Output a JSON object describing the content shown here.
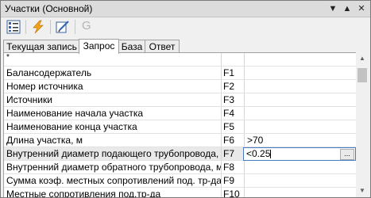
{
  "window": {
    "title": "Участки (Основной)",
    "controls": {
      "dropdown": "▼",
      "collapse": "▲",
      "close": "✕"
    }
  },
  "toolbar": {
    "buttons": [
      {
        "name": "list-view-icon",
        "enabled": true
      },
      {
        "name": "lightning-icon",
        "enabled": true
      },
      {
        "name": "edit-icon",
        "enabled": true
      },
      {
        "name": "g-icon",
        "label": "G",
        "enabled": false
      }
    ]
  },
  "tabs": [
    {
      "label": "Текущая запись",
      "active": false
    },
    {
      "label": "Запрос",
      "active": true
    },
    {
      "label": "База",
      "active": false
    },
    {
      "label": "Ответ",
      "active": false
    }
  ],
  "grid": {
    "header_marker": "*",
    "rows": [
      {
        "name": "Балансодержатель",
        "field": "F1",
        "value": ""
      },
      {
        "name": "Номер источника",
        "field": "F2",
        "value": ""
      },
      {
        "name": "Источники",
        "field": "F3",
        "value": ""
      },
      {
        "name": "Наименование начала участка",
        "field": "F4",
        "value": ""
      },
      {
        "name": "Наименование конца участка",
        "field": "F5",
        "value": ""
      },
      {
        "name": "Длина участка, м",
        "field": "F6",
        "value": ">70"
      },
      {
        "name": "Внутренний диаметр подающего трубопровода, м",
        "field": "F7",
        "value": "<0.25",
        "editing": true
      },
      {
        "name": "Внутренний диаметр обратного трубопровода, м",
        "field": "F8",
        "value": ""
      },
      {
        "name": "Сумма коэф. местных сопротивлений под. тр-да",
        "field": "F9",
        "value": ""
      },
      {
        "name": "Местные сопротивления под.тр-да",
        "field": "F10",
        "value": ""
      }
    ],
    "editor_button": "..."
  },
  "colors": {
    "title_bar": "#dcdcdc",
    "selected_row": "#e9e9e9",
    "editor_border": "#4a78c2",
    "lightning": "#f2a417"
  }
}
